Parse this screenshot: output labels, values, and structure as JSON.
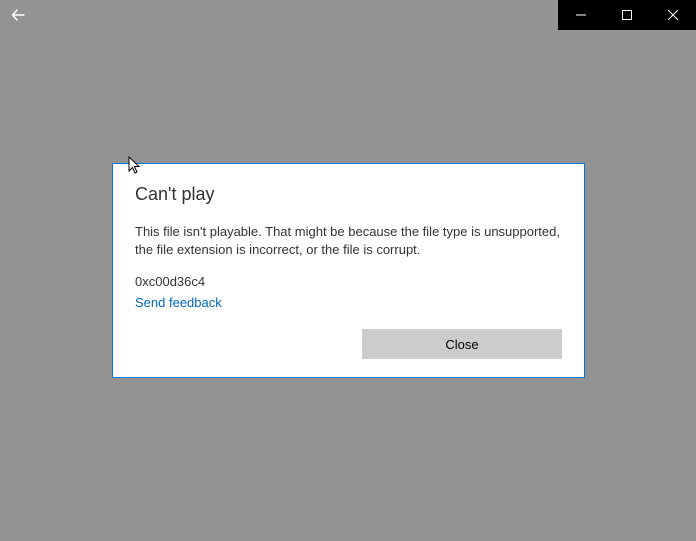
{
  "dialog": {
    "title": "Can't play",
    "message": "This file isn't playable. That might be because the file type is unsupported, the file extension is incorrect, or the file is corrupt.",
    "error_code": "0xc00d36c4",
    "feedback_label": "Send feedback",
    "close_label": "Close"
  }
}
